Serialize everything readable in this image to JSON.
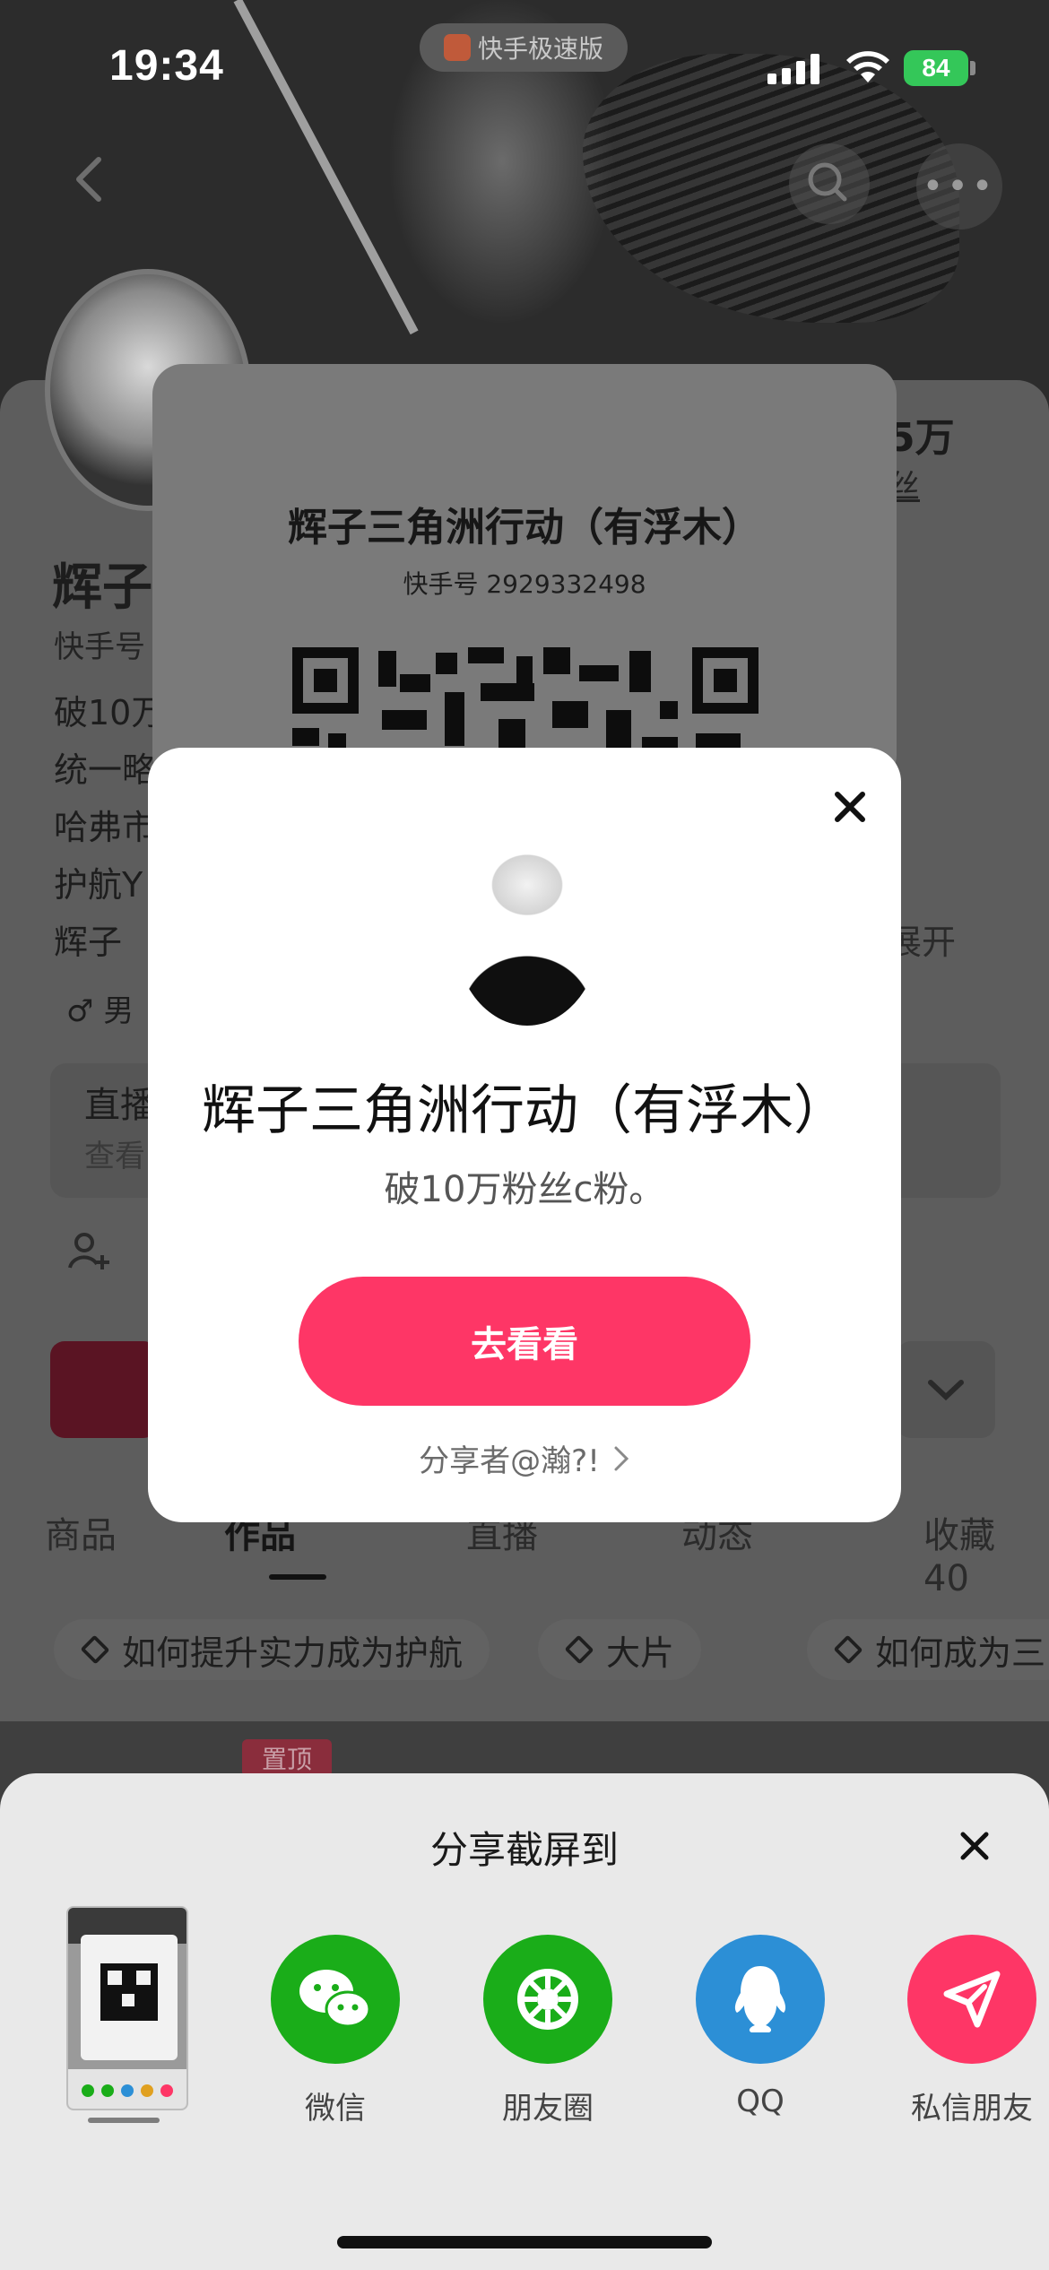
{
  "status_bar": {
    "time": "19:34",
    "app_pill": "快手极速版",
    "battery": "84"
  },
  "background": {
    "name": "辉子",
    "kuaishou_id_prefix": "快手号",
    "fans_count": "5万",
    "fans_label": "丝",
    "bio_lines": [
      "破10万",
      "统一略",
      "哈弗市",
      "护航Y",
      "辉子"
    ],
    "expand": "展开",
    "gender": "♂ 男",
    "live_title": "直播",
    "live_sub": "查看",
    "tabs": [
      "商品",
      "作品",
      "直播",
      "动态",
      "收藏 40"
    ],
    "chips": [
      "如何提升实力成为护航",
      "大片",
      "如何成为三"
    ],
    "pinned": "置顶"
  },
  "qr_card": {
    "title": "辉子三角洲行动（有浮木）",
    "kuaishou_id": "快手号 2929332498"
  },
  "modal": {
    "title": "辉子三角洲行动（有浮木）",
    "subtitle": "破10万粉丝c粉。",
    "button": "去看看",
    "sharer": "分享者@瀚?!"
  },
  "share_sheet": {
    "title": "分享截屏到",
    "targets": [
      {
        "label": "微信",
        "color": "#1aad19",
        "icon": "wechat-icon"
      },
      {
        "label": "朋友圈",
        "color": "#1aad19",
        "icon": "moments-icon"
      },
      {
        "label": "QQ",
        "color": "#2c8fd6",
        "icon": "qq-icon"
      },
      {
        "label": "私信朋友",
        "color": "#fe3666",
        "icon": "send-icon"
      }
    ]
  }
}
